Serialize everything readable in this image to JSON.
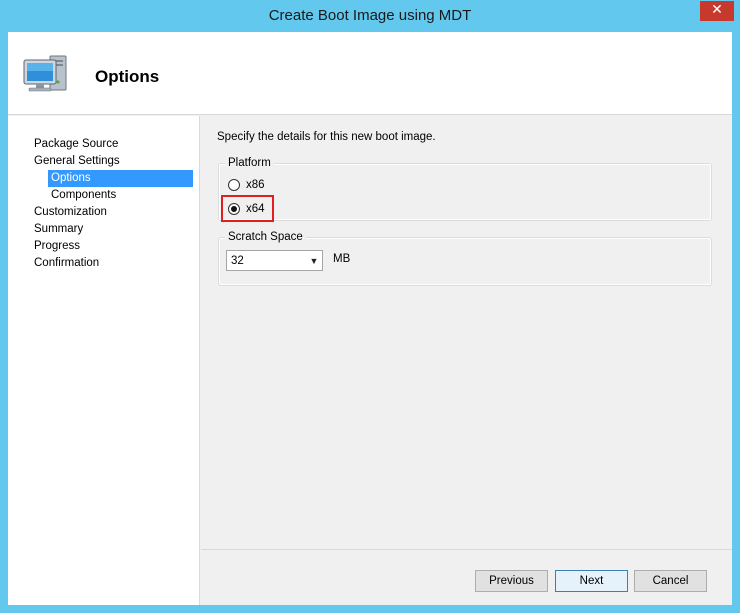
{
  "window": {
    "title": "Create Boot Image using MDT",
    "close_glyph": "✕"
  },
  "header": {
    "icon": "computer-icon",
    "title": "Options"
  },
  "nav": {
    "items": [
      {
        "label": "Package Source",
        "level": 0,
        "selected": false
      },
      {
        "label": "General Settings",
        "level": 0,
        "selected": false
      },
      {
        "label": "Options",
        "level": 1,
        "selected": true
      },
      {
        "label": "Components",
        "level": 1,
        "selected": false
      },
      {
        "label": "Customization",
        "level": 0,
        "selected": false
      },
      {
        "label": "Summary",
        "level": 0,
        "selected": false
      },
      {
        "label": "Progress",
        "level": 0,
        "selected": false
      },
      {
        "label": "Confirmation",
        "level": 0,
        "selected": false
      }
    ]
  },
  "content": {
    "intro": "Specify the details for this new boot image.",
    "platform": {
      "label": "Platform",
      "options": [
        {
          "label": "x86",
          "checked": false
        },
        {
          "label": "x64",
          "checked": true
        }
      ]
    },
    "scratch": {
      "label": "Scratch Space",
      "value": "32",
      "unit": "MB"
    }
  },
  "footer": {
    "previous": "Previous",
    "next": "Next",
    "cancel": "Cancel"
  },
  "colors": {
    "frame": "#62c8ee",
    "selection": "#3399ff",
    "highlight": "#e02020",
    "close": "#c7392c"
  }
}
